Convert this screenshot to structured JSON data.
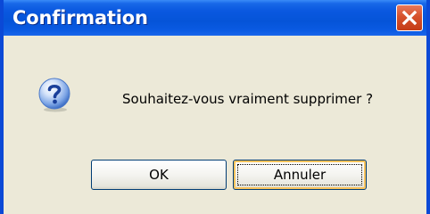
{
  "window": {
    "title": "Confirmation",
    "close_icon": "close-icon"
  },
  "dialog": {
    "icon": "question-icon",
    "message": "Souhaitez-vous vraiment supprimer ?"
  },
  "buttons": {
    "ok_label": "OK",
    "cancel_label": "Annuler",
    "focused": "cancel"
  },
  "colors": {
    "title_bar": "#0554d8",
    "close_button": "#d6512c",
    "dialog_background": "#ece9d8",
    "question_icon": "#1e62d0",
    "focus_highlight": "#f9c35c"
  }
}
